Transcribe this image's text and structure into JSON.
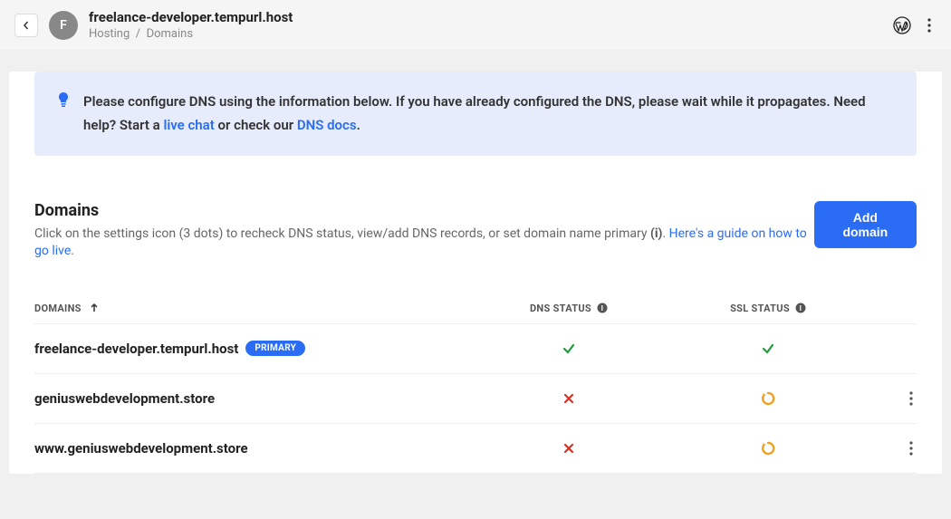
{
  "header": {
    "avatar_letter": "F",
    "title": "freelance-developer.tempurl.host",
    "breadcrumb1": "Hosting",
    "breadcrumb_sep": "/",
    "breadcrumb2": "Domains"
  },
  "banner": {
    "text1": "Please configure DNS using the information below. If you have already configured the DNS, please wait while it propagates. Need help? Start a ",
    "link1": "live chat",
    "text2": " or check our ",
    "link2": "DNS docs",
    "text3": "."
  },
  "section": {
    "title": "Domains",
    "sub1": "Click on the settings icon (3 dots) to recheck DNS status, view/add DNS records, or set domain name primary ",
    "sub_bold": "(i)",
    "sub2": ". ",
    "sub_link": "Here's a guide on how to go live",
    "sub3": ".",
    "add_btn": "Add domain"
  },
  "table": {
    "col_domains": "DOMAINS",
    "col_dns": "DNS STATUS",
    "col_ssl": "SSL STATUS",
    "primary_badge": "PRIMARY",
    "rows": [
      {
        "name": "freelance-developer.tempurl.host",
        "primary": true,
        "dns": "ok",
        "ssl": "ok",
        "actions": false
      },
      {
        "name": "geniuswebdevelopment.store",
        "primary": false,
        "dns": "fail",
        "ssl": "pending",
        "actions": true
      },
      {
        "name": "www.geniuswebdevelopment.store",
        "primary": false,
        "dns": "fail",
        "ssl": "pending",
        "actions": true
      }
    ]
  }
}
